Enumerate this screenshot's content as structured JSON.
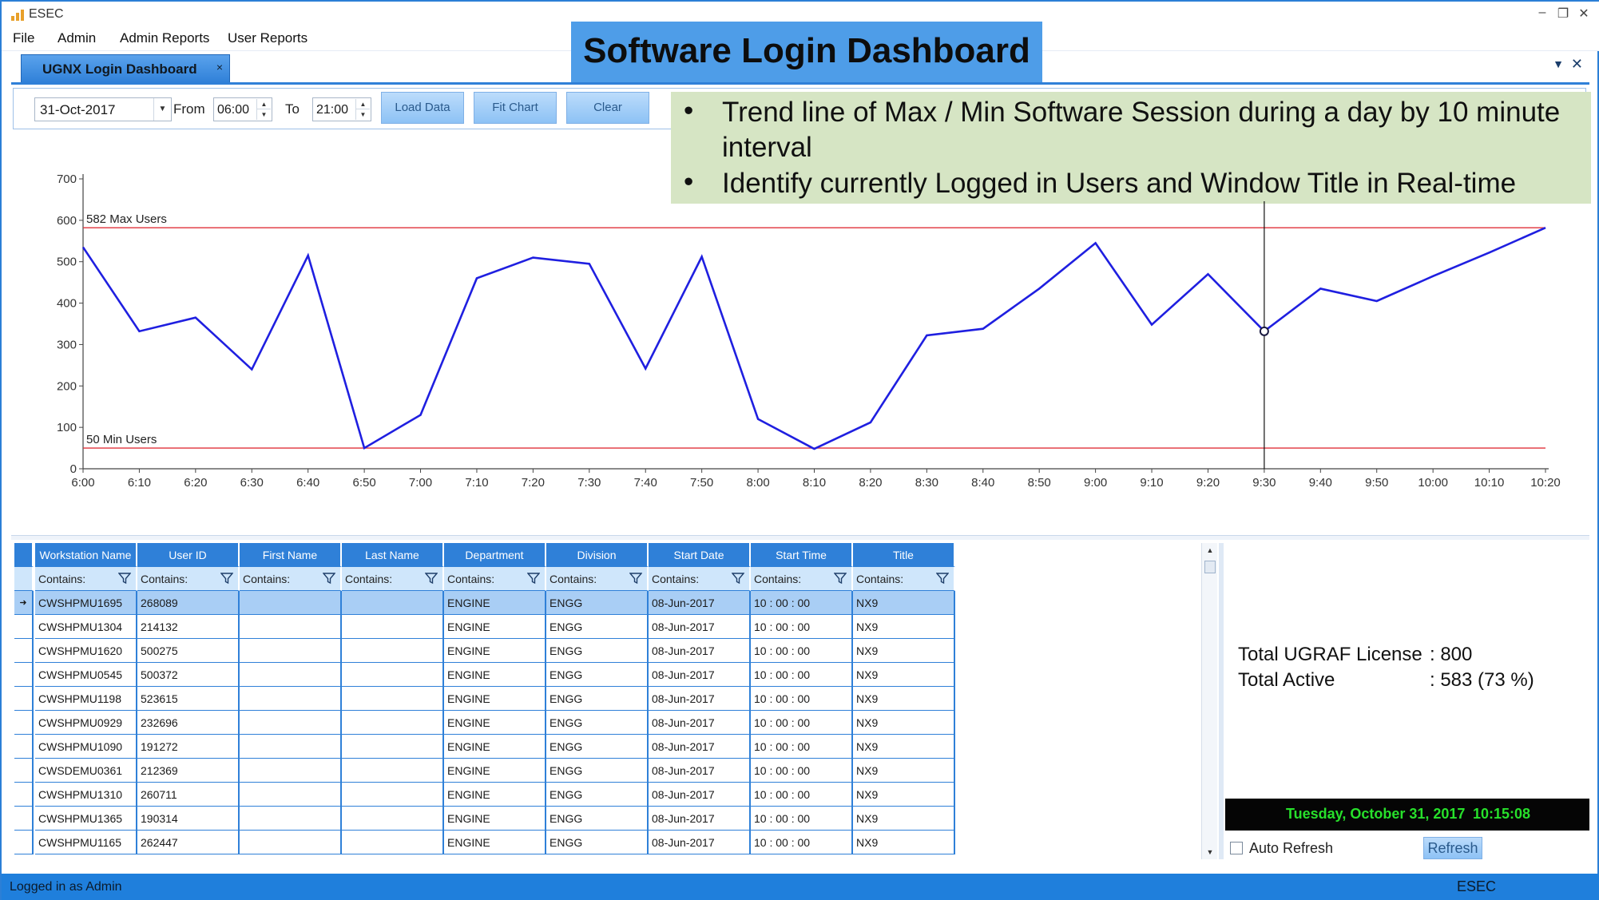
{
  "window": {
    "title": "ESEC",
    "minimize": "–",
    "restore": "❐",
    "close": "✕"
  },
  "menu": [
    "File",
    "Admin",
    "Admin Reports",
    "User Reports"
  ],
  "doc_tab": {
    "label": "UGNX Login Dashboard",
    "close": "×"
  },
  "pane_controls": {
    "menu": "▼",
    "close": "✕"
  },
  "toolbar": {
    "date": "31-Oct-2017",
    "from_label": "From",
    "from_value": "06:00",
    "to_label": "To",
    "to_value": "21:00",
    "load_label": "Load Data",
    "fit_label": "Fit Chart",
    "clear_label": "Clear"
  },
  "callout": {
    "title": "Software Login Dashboard",
    "bullet": "•",
    "notes": [
      "Trend line of Max / Min Software Session during a day by 10 minute interval",
      "Identify currently Logged in Users and Window Title in Real-time"
    ]
  },
  "chart_data": {
    "type": "line",
    "x": [
      "6:00",
      "6:10",
      "6:20",
      "6:30",
      "6:40",
      "6:50",
      "7:00",
      "7:10",
      "7:20",
      "7:30",
      "7:40",
      "7:50",
      "8:00",
      "8:10",
      "8:20",
      "8:30",
      "8:40",
      "8:50",
      "9:00",
      "9:10",
      "9:20",
      "9:30",
      "9:40",
      "9:50",
      "10:00",
      "10:10",
      "10:20"
    ],
    "series": [
      {
        "values": [
          535,
          332,
          365,
          240,
          515,
          50,
          130,
          460,
          510,
          495,
          242,
          512,
          120,
          48,
          112,
          322,
          338,
          435,
          545,
          348,
          470,
          332,
          435,
          405,
          465,
          522,
          582
        ],
        "color": "#1f1fe0"
      }
    ],
    "reference_lines": [
      {
        "label": "582 Max Users",
        "value": 582,
        "color": "#e0303a"
      },
      {
        "label": "50 Min Users",
        "value": 50,
        "color": "#e0303a"
      }
    ],
    "cursor_x": "9:30",
    "yticks": [
      0,
      100,
      200,
      300,
      400,
      500,
      600,
      700
    ],
    "ylim": [
      0,
      700
    ],
    "grid": false
  },
  "grid": {
    "columns": [
      "Workstation Name",
      "User ID",
      "First Name",
      "Last Name",
      "Department",
      "Division",
      "Start Date",
      "Start Time",
      "Title"
    ],
    "filter_label": "Contains:",
    "selected_marker": "➜",
    "rows": [
      [
        "CWSHPMU1695",
        "268089",
        "",
        "",
        "ENGINE",
        "ENGG",
        "08-Jun-2017",
        "10 : 00 : 00",
        "NX9"
      ],
      [
        "CWSHPMU1304",
        "214132",
        "",
        "",
        "ENGINE",
        "ENGG",
        "08-Jun-2017",
        "10 : 00 : 00",
        "NX9"
      ],
      [
        "CWSHPMU1620",
        "500275",
        "",
        "",
        "ENGINE",
        "ENGG",
        "08-Jun-2017",
        "10 : 00 : 00",
        "NX9"
      ],
      [
        "CWSHPMU0545",
        "500372",
        "",
        "",
        "ENGINE",
        "ENGG",
        "08-Jun-2017",
        "10 : 00 : 00",
        "NX9"
      ],
      [
        "CWSHPMU1198",
        "523615",
        "",
        "",
        "ENGINE",
        "ENGG",
        "08-Jun-2017",
        "10 : 00 : 00",
        "NX9"
      ],
      [
        "CWSHPMU0929",
        "232696",
        "",
        "",
        "ENGINE",
        "ENGG",
        "08-Jun-2017",
        "10 : 00 : 00",
        "NX9"
      ],
      [
        "CWSHPMU1090",
        "191272",
        "",
        "",
        "ENGINE",
        "ENGG",
        "08-Jun-2017",
        "10 : 00 : 00",
        "NX9"
      ],
      [
        "CWSDEMU0361",
        "212369",
        "",
        "",
        "ENGINE",
        "ENGG",
        "08-Jun-2017",
        "10 : 00 : 00",
        "NX9"
      ],
      [
        "CWSHPMU1310",
        "260711",
        "",
        "",
        "ENGINE",
        "ENGG",
        "08-Jun-2017",
        "10 : 00 : 00",
        "NX9"
      ],
      [
        "CWSHPMU1365",
        "190314",
        "",
        "",
        "ENGINE",
        "ENGG",
        "08-Jun-2017",
        "10 : 00 : 00",
        "NX9"
      ],
      [
        "CWSHPMU1165",
        "262447",
        "",
        "",
        "ENGINE",
        "ENGG",
        "08-Jun-2017",
        "10 : 00 : 00",
        "NX9"
      ]
    ]
  },
  "scrollbar": {
    "up": "▲",
    "down": "▼"
  },
  "summary": {
    "license_label": "Total UGRAF License",
    "license_value": ": 800",
    "active_label": "Total Active",
    "active_value": ": 583 (73 %)"
  },
  "clock": {
    "date": "Tuesday, October 31, 2017",
    "time": "10:15:08"
  },
  "auto_refresh_label": "Auto Refresh",
  "refresh_label": "Refresh",
  "status": {
    "left": "Logged in as Admin",
    "right": "ESEC"
  }
}
